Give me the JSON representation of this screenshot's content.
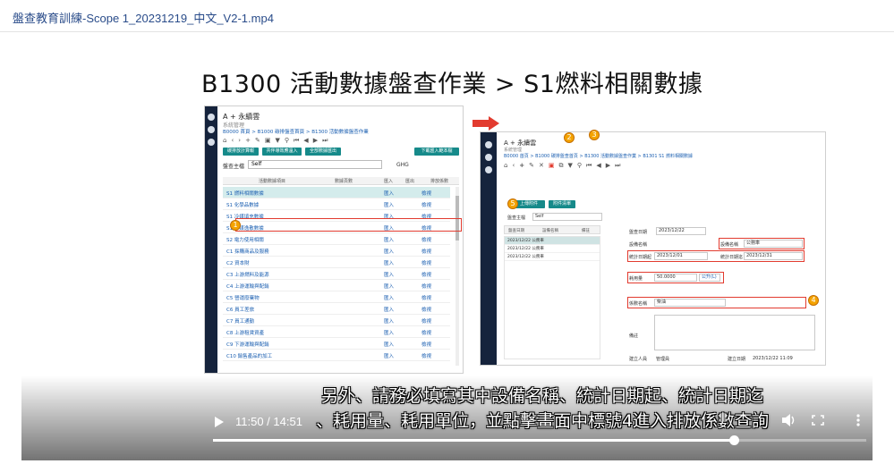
{
  "page": {
    "file_title": "盤查教育訓練-Scope 1_20231219_中文_V2-1.mp4"
  },
  "slide": {
    "heading": "B1300 活動數據盤查作業 > S1燃料相關數據",
    "left_screen": {
      "app_title": "A + 永續雲",
      "subtitle": "系統管理",
      "breadcrumb": "B0000 首頁 > B1000 碳排盤查首頁 > B1300 活動數據盤查作業",
      "buttons": [
        "碳排放計算報表",
        "共伴導效應溫入",
        "全部數據匯出",
        "下載匯入範本檔"
      ],
      "field_label": "盤查主檔",
      "field_value": "Self",
      "field_right": "GHG",
      "table_headers": [
        "活動數據項目",
        "數據頁數",
        "匯入",
        "匯出",
        "排放係數"
      ],
      "rows": [
        {
          "name": "S1 燃料相關數據",
          "a": "匯入",
          "b": "檢視"
        },
        {
          "name": "S1 化學品數據",
          "a": "匯入",
          "b": "檢視"
        },
        {
          "name": "S1 冷媒填充數據",
          "a": "匯入",
          "b": "檢視"
        },
        {
          "name": "S1 冷媒逸散數據",
          "a": "匯入",
          "b": "檢視"
        },
        {
          "name": "S2 電力使用相關",
          "a": "匯入",
          "b": "檢視"
        },
        {
          "name": "C1 採購商品及服務",
          "a": "匯入",
          "b": "檢視"
        },
        {
          "name": "C2 資本財",
          "a": "匯入",
          "b": "檢視"
        },
        {
          "name": "C3 上游燃料及能源",
          "a": "匯入",
          "b": "檢視"
        },
        {
          "name": "C4 上游運輸與配銷",
          "a": "匯入",
          "b": "檢視"
        },
        {
          "name": "C5 營運廢棄物",
          "a": "匯入",
          "b": "檢視"
        },
        {
          "name": "C6 員工差旅",
          "a": "匯入",
          "b": "檢視"
        },
        {
          "name": "C7 員工通勤",
          "a": "匯入",
          "b": "檢視"
        },
        {
          "name": "C8 上游租賃資產",
          "a": "匯入",
          "b": "檢視"
        },
        {
          "name": "C9 下游運輸與配銷",
          "a": "匯入",
          "b": "檢視"
        },
        {
          "name": "C10 銷售產品的加工",
          "a": "匯入",
          "b": "檢視"
        }
      ]
    },
    "right_screen": {
      "app_title": "A + 永續雲",
      "subtitle": "系統管理",
      "breadcrumb": "B0000 首頁 > B1000 碳排盤查首頁 > B1300 活動數據盤查作業 > B1301 S1 燃料相關數據",
      "btn_save": "上傳附件",
      "btn_sub": "附件清單",
      "grid_headers": [
        "盤查日期",
        "設備名稱",
        "備註"
      ],
      "grid_rows": [
        "2023/12/22 公務車",
        "2023/12/22 公務車",
        "2023/12/22 公務車"
      ],
      "form": {
        "date_label": "盤查日期",
        "date_value": "2023/12/22",
        "device_label": "設備名稱",
        "device_value": "公務車",
        "start_label": "統計日期起",
        "start_value": "2023/12/01",
        "end_label": "統計日期迄",
        "end_value": "2023/12/31",
        "usage_label": "耗用量",
        "usage_value": "50.0000",
        "unit_value": "公升(L)",
        "coef_label": "係數名稱",
        "coef_value": "柴油",
        "note_label": "備註",
        "creator_label": "建立人員",
        "creator_value": "管理員",
        "created_label": "建立日期",
        "created_value": "2023/12/22 11:09"
      }
    },
    "markers": [
      "1",
      "2",
      "3",
      "4",
      "5"
    ]
  },
  "subtitles": {
    "line1": "另外、請務必填寫其中設備名稱、統計日期起、統計日期迄",
    "line2": "、耗用量、耗用單位，並點擊畫面中標號4進入排放係數查詢"
  },
  "player": {
    "time": "11:50 / 14:51",
    "progress": 0.797
  }
}
